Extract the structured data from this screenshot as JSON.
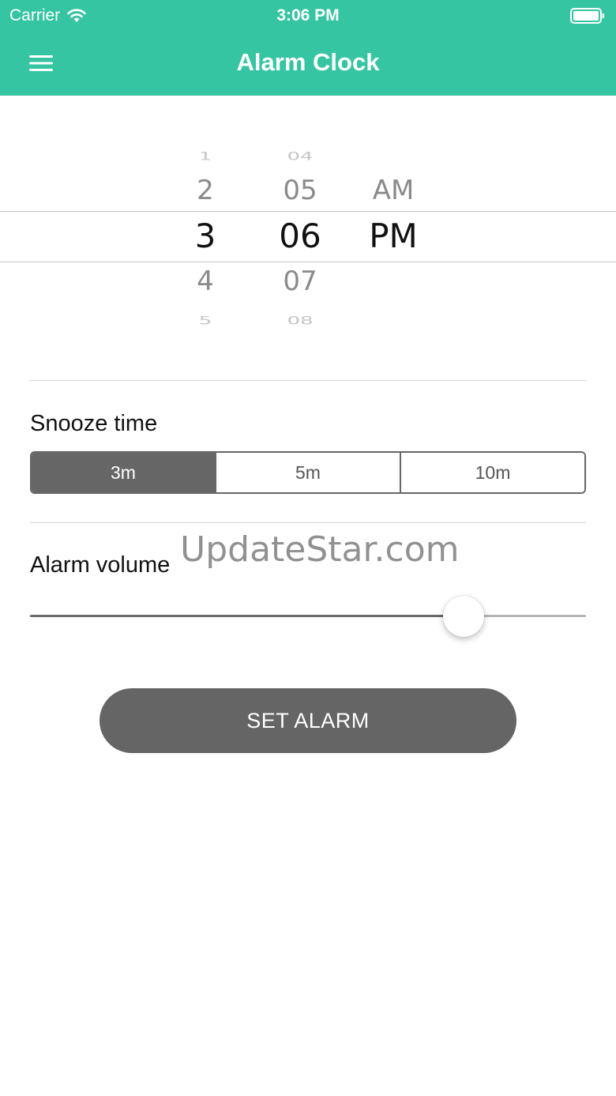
{
  "status_bar": {
    "carrier": "Carrier",
    "time": "3:06 PM",
    "wifi_icon": "wifi-icon",
    "battery_icon": "battery-icon"
  },
  "nav": {
    "title": "Alarm Clock",
    "menu_icon": "hamburger-menu-icon"
  },
  "time_picker": {
    "hours": [
      "1",
      "2",
      "3",
      "4",
      "5"
    ],
    "minutes": [
      "04",
      "05",
      "06",
      "07",
      "08"
    ],
    "periods": [
      "AM",
      "PM"
    ],
    "selected_hour": "3",
    "selected_minute": "06",
    "selected_period": "PM"
  },
  "snooze": {
    "label": "Snooze time",
    "options": [
      "3m",
      "5m",
      "10m"
    ],
    "selected": "3m"
  },
  "volume": {
    "label": "Alarm volume",
    "value_percent": 78
  },
  "watermark": "UpdateStar.com",
  "set_alarm_label": "SET ALARM",
  "colors": {
    "header": "#36c5a2",
    "button": "#656565",
    "segment_active": "#666666"
  }
}
